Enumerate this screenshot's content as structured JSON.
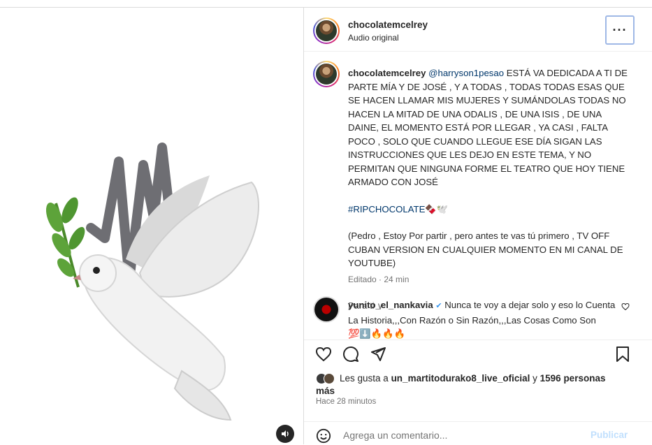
{
  "post": {
    "username": "chocolatemcelrey",
    "audio": "Audio original",
    "more_label": "···"
  },
  "caption": {
    "username": "chocolatemcelrey",
    "mention": "@harryson1pesao",
    "text": " ESTÁ VA DEDICADA A TI DE PARTE MÍA Y DE JOSÉ , Y A TODAS , TODAS TODAS ESAS QUE SE HACEN LLAMAR MIS MUJERES Y SUMÁNDOLAS TODAS NO HACEN LA MITAD DE UNA ODALIS , DE UNA ISIS , DE UNA DAINE, EL MOMENTO ESTÁ POR LLEGAR , YA CASI , FALTA POCO , SOLO QUE CUANDO LLEGUE ESE DÍA SIGAN LAS INSTRUCCIONES QUE LES DEJO EN ESTE TEMA, Y NO PERMITAN QUE NINGUNA FORME EL TEATRO QUE HOY TIENE ARMADO CON JOSÉ",
    "hashtag": "#RIPCHOCOLATE",
    "hashtag_emoji": "🍫🕊️",
    "extra": "(Pedro , Estoy Por partir , pero antes te vas tú primero , TV OFF CUBAN VERSION EN CUALQUIER MOMENTO EN MI CANAL DE YOUTUBE)",
    "edited": "Editado · 24 min"
  },
  "translation": {
    "label": "Para ti",
    "chevron": "∨"
  },
  "comment": {
    "username": "yunito_el_nankavia",
    "verified": "✔",
    "text": " Nunca te voy a dejar solo y eso lo Cuenta La Historia,,,Con Razón o Sin Razón,,,Las Cosas Como Son 💯⬇️🔥🔥🔥"
  },
  "likes": {
    "prefix": "Les gusta a ",
    "user": "un_martitodurako8_live_oficial",
    "middle": " y ",
    "count": "1596 personas",
    "suffix": "más"
  },
  "time": "Hace 28 minutos",
  "composer": {
    "placeholder": "Agrega un comentario...",
    "publish": "Publicar"
  },
  "icons": {
    "like": "heart-icon",
    "comment": "comment-icon",
    "share": "share-icon",
    "save": "bookmark-icon",
    "emoji": "emoji-icon",
    "volume": "volume-icon"
  }
}
